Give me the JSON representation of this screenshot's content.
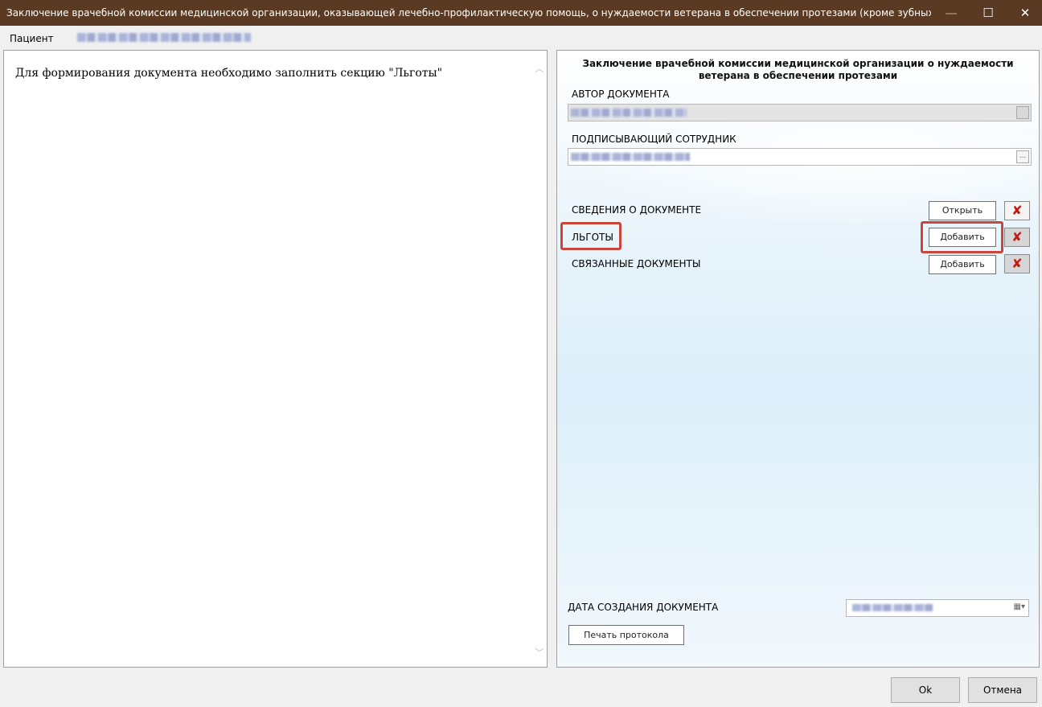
{
  "window": {
    "title": "Заключение врачебной комиссии медицинской организации, оказывающей лечебно-профилактическую помощь, о нуждаемости ветерана в обеспечении протезами (кроме зубных протезов), протезно-...",
    "controls": {
      "minimize": "—",
      "maximize": "☐",
      "close": "✕"
    }
  },
  "patient": {
    "label": "Пациент"
  },
  "left_panel": {
    "message": "Для формирования документа необходимо заполнить секцию \"Льготы\"",
    "scroll_up": "︿",
    "scroll_down": "﹀"
  },
  "right_panel": {
    "title": "Заключение врачебной комиссии медицинской организации о нуждаемости ветерана в обеспечении протезами",
    "author_label": "АВТОР ДОКУМЕНТА",
    "signer_label": "ПОДПИСЫВАЮЩИЙ СОТРУДНИК",
    "signer_button": "...",
    "sections": [
      {
        "label": "СВЕДЕНИЯ О ДОКУМЕНТЕ",
        "button": "Открыть"
      },
      {
        "label": "ЛЬГОТЫ",
        "button": "Добавить"
      },
      {
        "label": "СВЯЗАННЫЕ ДОКУМЕНТЫ",
        "button": "Добавить"
      }
    ],
    "delete_glyph": "✘",
    "date_label": "ДАТА СОЗДАНИЯ ДОКУМЕНТА",
    "date_dropdown": "▦▾",
    "print_button": "Печать протокола"
  },
  "footer": {
    "ok": "Ok",
    "cancel": "Отмена"
  },
  "colors": {
    "titlebar": "#5a3a22",
    "highlight": "#c8473a",
    "delete_icon": "#c41a12"
  }
}
